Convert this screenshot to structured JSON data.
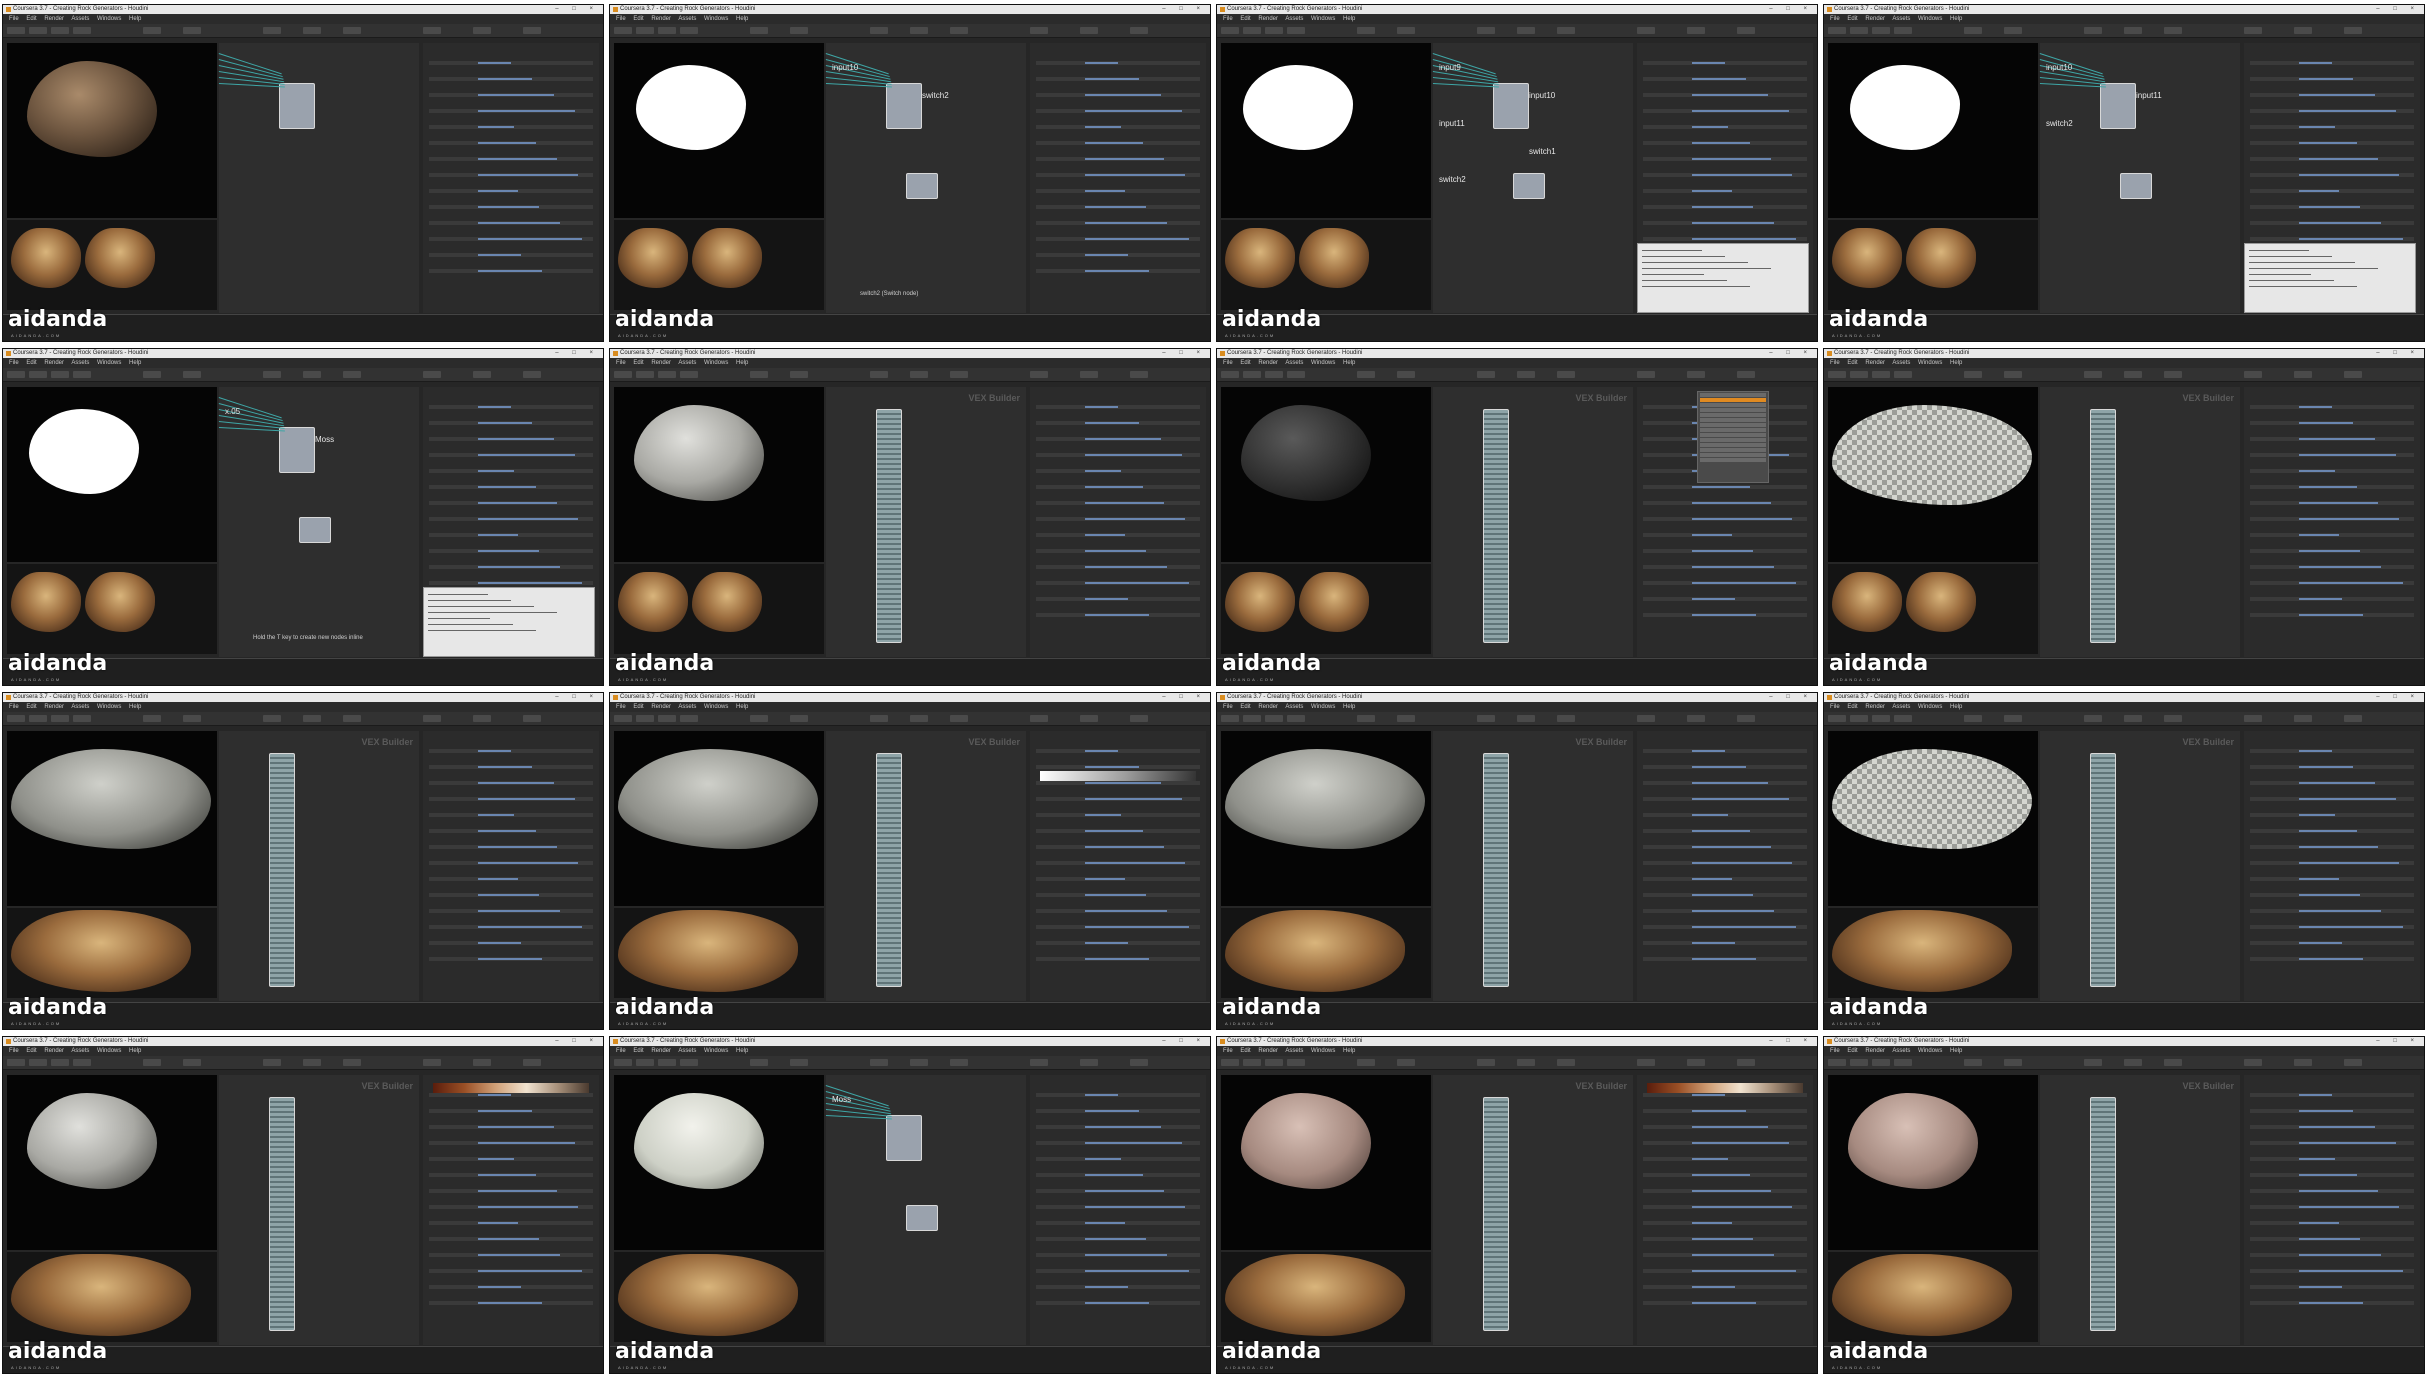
{
  "colors": {
    "accent": "#e08a21",
    "wire": "#3ea6a6",
    "node": "#9aa2ad",
    "panel": "#2b2b2b"
  },
  "logo": {
    "text": "aidanda",
    "sub": "AIDANDA.COM"
  },
  "frames": [
    {
      "title": "Coursera 3.7 - Creating Rock Generators - Houdini",
      "view": "rock-natural",
      "graph": "switch-net",
      "captions": [],
      "labels": []
    },
    {
      "title": "Coursera 3.7 - Creating Rock Generators - Houdini",
      "view": "mask",
      "graph": "radial-menu",
      "captions": [
        "switch2 (Switch node)"
      ],
      "labels": [
        "input10",
        "switch2"
      ]
    },
    {
      "title": "Coursera 3.7 - Creating Rock Generators - Houdini",
      "view": "mask",
      "graph": "switch-pair",
      "captions": [],
      "labels": [
        "input9",
        "input10",
        "input11",
        "switch1",
        "switch2"
      ]
    },
    {
      "title": "Coursera 3.7 - Creating Rock Generators - Houdini",
      "view": "mask",
      "graph": "switch-pair",
      "captions": [],
      "labels": [
        "input10",
        "input11",
        "switch2"
      ]
    },
    {
      "title": "Coursera 3.7 - Creating Rock Generators - Houdini",
      "view": "mask",
      "graph": "moss-net",
      "captions": [
        "Hold the T key to create new nodes inline"
      ],
      "labels": [
        "x.05",
        "Moss"
      ]
    },
    {
      "title": "Coursera 3.7 - Creating Rock Generators - Houdini",
      "view": "rock-grey",
      "graph": "vex-builder",
      "captions": [],
      "labels": []
    },
    {
      "title": "Coursera 3.7 - Creating Rock Generators - Houdini",
      "view": "rock-dark",
      "graph": "vex-builder",
      "captions": [],
      "labels": []
    },
    {
      "title": "Coursera 3.7 - Creating Rock Generators - Houdini",
      "view": "rock-pixel",
      "graph": "vex-builder",
      "captions": [],
      "labels": []
    },
    {
      "title": "Coursera 3.7 - Creating Rock Generators - Houdini",
      "view": "rock-grey-wide",
      "graph": "vex-builder",
      "captions": [],
      "labels": []
    },
    {
      "title": "Coursera 3.7 - Creating Rock Generators - Houdini",
      "view": "rock-grey-wide",
      "graph": "vex-builder-ramp",
      "captions": [],
      "labels": []
    },
    {
      "title": "Coursera 3.7 - Creating Rock Generators - Houdini",
      "view": "rock-grey-wide",
      "graph": "vex-builder",
      "captions": [],
      "labels": []
    },
    {
      "title": "Coursera 3.7 - Creating Rock Generators - Houdini",
      "view": "rock-pixel",
      "graph": "vex-builder",
      "captions": [],
      "labels": []
    },
    {
      "title": "Coursera 3.7 - Creating Rock Generators - Houdini",
      "view": "rock-grey",
      "graph": "vex-builder-gradient",
      "captions": [],
      "labels": []
    },
    {
      "title": "Coursera 3.7 - Creating Rock Generators - Houdini",
      "view": "rock-pale",
      "graph": "moss-graph",
      "captions": [],
      "labels": [
        "Moss"
      ]
    },
    {
      "title": "Coursera 3.7 - Creating Rock Generators - Houdini",
      "view": "rock-pink",
      "graph": "vex-builder-gradient",
      "captions": [],
      "labels": []
    },
    {
      "title": "Coursera 3.7 - Creating Rock Generators - Houdini",
      "view": "rock-pink",
      "graph": "vex-builder",
      "captions": [],
      "labels": []
    }
  ],
  "menu": "File Edit Render Assets Windows Help",
  "vex_label": "VEX Builder"
}
